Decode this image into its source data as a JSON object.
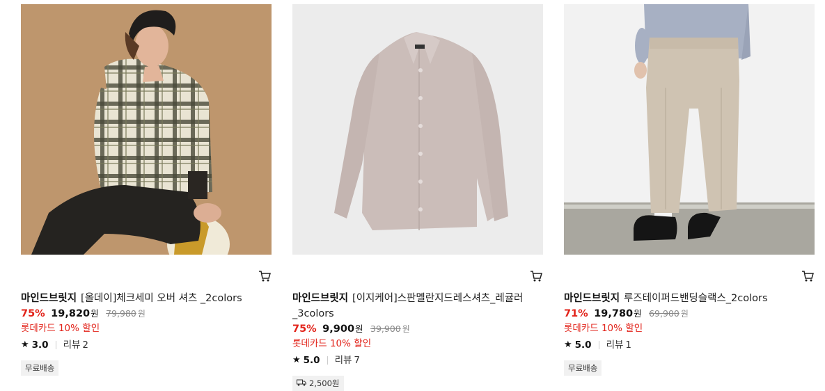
{
  "products": [
    {
      "brand": "마인드브릿지",
      "name": "[올데이]체크세미 오버 셔츠 _2colors",
      "discount": "75%",
      "price": "19,820",
      "price_unit": "원",
      "original_price": "79,980",
      "original_unit": "원",
      "card_promo": "롯데카드 10% 할인",
      "rating": "3.0",
      "review_label": "리뷰",
      "review_count": "2",
      "badge": "무료배송",
      "image_icon": "model-plaid-shirt-image"
    },
    {
      "brand": "마인드브릿지",
      "name": "[이지케어]스판멜란지드레스셔츠_레귤러_3colors",
      "discount": "75%",
      "price": "9,900",
      "price_unit": "원",
      "original_price": "39,900",
      "original_unit": "원",
      "card_promo": "롯데카드 10% 할인",
      "rating": "5.0",
      "review_label": "리뷰",
      "review_count": "7",
      "badge": "2,500원",
      "badge_icon": "truck-icon",
      "image_icon": "dress-shirt-image"
    },
    {
      "brand": "마인드브릿지",
      "name": "루즈테이퍼드밴딩슬랙스_2colors",
      "discount": "71%",
      "price": "19,780",
      "price_unit": "원",
      "original_price": "69,900",
      "original_unit": "원",
      "card_promo": "롯데카드 10% 할인",
      "rating": "5.0",
      "review_label": "리뷰",
      "review_count": "1",
      "badge": "무료배송",
      "image_icon": "model-slacks-image"
    }
  ],
  "colors": {
    "discount": "#e2231a",
    "card_promo": "#e2231a",
    "badge_bg": "#f1f1f1"
  },
  "icons": {
    "cart": "cart-icon",
    "star": "star-icon"
  }
}
